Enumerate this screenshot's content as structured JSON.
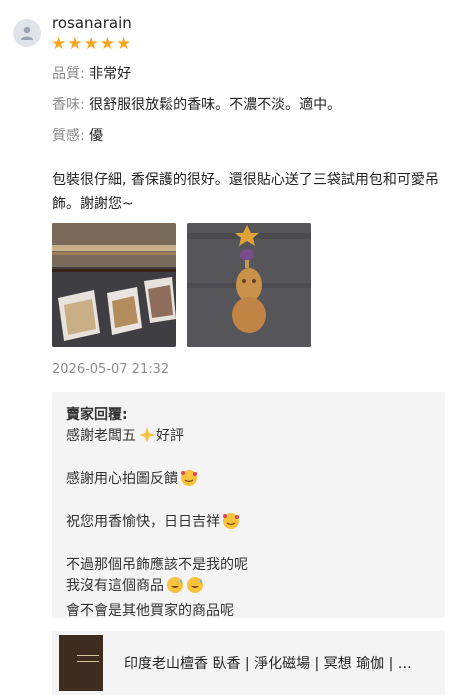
{
  "review": {
    "username": "rosanarain",
    "rating": 5,
    "attributes": [
      {
        "label": "品質:",
        "value": "非常好"
      },
      {
        "label": "香味:",
        "value": "很舒服很放鬆的香味。不濃不淡。適中。"
      },
      {
        "label": "質感:",
        "value": "優"
      }
    ],
    "text": "包裝很仔細, 香保護的很好。還很貼心送了三袋試用包和可愛吊飾。謝謝您~",
    "timestamp": "2026-05-07 21:32"
  },
  "seller_reply": {
    "title": "賣家回覆:",
    "line1_a": "感謝老闆五",
    "line1_b": "好評",
    "line2": "感謝用心拍圖反饋",
    "line3": "祝您用香愉快，日日吉祥",
    "line4": "不過那個吊飾應該不是我的呢",
    "line5": "我沒有這個商品",
    "line6": "會不會是其他買家的商品呢"
  },
  "product": {
    "title": "印度老山檀香 臥香 | 淨化磁場 | 冥想 瑜伽 | 禪修"
  },
  "colors": {
    "star": "#f5a623",
    "reply_bg": "#f4f4f4",
    "muted": "#8a8a8a"
  },
  "icons": {
    "avatar": "user-icon",
    "star": "star-icon"
  }
}
